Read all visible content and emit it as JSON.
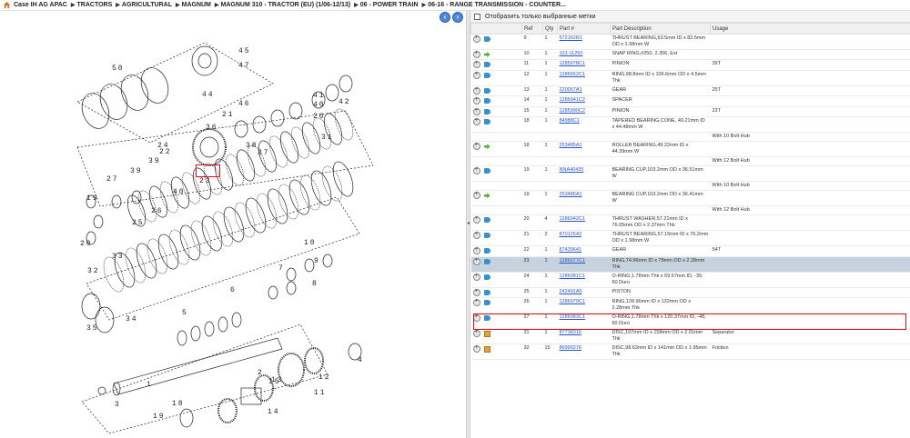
{
  "breadcrumb": [
    "Case IH AG APAC",
    "TRACTORS",
    "AGRICULTURAL",
    "MAGNUM",
    "MAGNUM 310 - TRACTOR (EU) (1/06-12/13)",
    "06 - POWER TRAIN",
    "06-16 - RANGE TRANSMISSION - COUNTER..."
  ],
  "filter_label": "Отобразить только выбранные метки",
  "columns": [
    "",
    "Ref",
    "Qty",
    "Part #",
    "Part Description",
    "Usage"
  ],
  "diagram_labels": [
    "50",
    "45",
    "47",
    "44",
    "42",
    "41",
    "40",
    "20",
    "46",
    "21",
    "36",
    "37",
    "38",
    "22",
    "24",
    "39",
    "23",
    "31",
    "27",
    "39",
    "40",
    "26",
    "25",
    "19",
    "20",
    "33",
    "32",
    "35",
    "34",
    "10",
    "9",
    "8",
    "7",
    "5",
    "6",
    "3",
    "4",
    "1",
    "2",
    "18",
    "19",
    "14",
    "13",
    "11",
    "12",
    "15"
  ],
  "rows": [
    {
      "ref": "9",
      "qty": "1",
      "part": "572162R1",
      "desc": "THRUST BEARING,63.5mm ID x 82.5mm OD x 1.98mm W",
      "usage": "",
      "icon": "blue"
    },
    {
      "ref": "10",
      "qty": "1",
      "part": "101-11250",
      "desc": "SNAP RING,#250, 2.356, Ext",
      "usage": "",
      "icon": "green"
    },
    {
      "ref": "11",
      "qty": "1",
      "part": "1285978C1",
      "desc": "PINION",
      "usage": "39T",
      "icon": "blue"
    },
    {
      "ref": "12",
      "qty": "1",
      "part": "1286652C1",
      "desc": "RING,98.8mm ID x 106.6mm OD x 4.5mm Thk",
      "usage": "",
      "icon": "blue"
    },
    {
      "ref": "13",
      "qty": "1",
      "part": "220057A1",
      "desc": "GEAR",
      "usage": "25T",
      "icon": "blue"
    },
    {
      "ref": "14",
      "qty": "1",
      "part": "1286041C2",
      "desc": "SPACER",
      "usage": "",
      "icon": "blue"
    },
    {
      "ref": "15",
      "qty": "1",
      "part": "1285990C2",
      "desc": "PINION",
      "usage": "23T",
      "icon": "blue"
    },
    {
      "ref": "18",
      "qty": "1",
      "part": "84988C1",
      "desc": "TAPERED BEARING,CONE, 49.21mm ID x 44.48mm W",
      "usage": "",
      "icon": "blue",
      "sub": "With 10 Bolt Hub"
    },
    {
      "ref": "18",
      "qty": "1",
      "part": "253485A1",
      "desc": "ROLLER BEARING,49.22mm ID x 44.39mm W",
      "usage": "",
      "icon": "green",
      "sub": "With 12 Bolt Hub"
    },
    {
      "ref": "19",
      "qty": "1",
      "part": "NNA40435",
      "desc": "BEARING CUP,103.2mm OD x 36.51mm W",
      "usage": "",
      "icon": "blue",
      "sub": "With 10 Bolt Hub"
    },
    {
      "ref": "19",
      "qty": "1",
      "part": "253486A1",
      "desc": "BEARING CUP,103.2mm OD x 36.41mm W",
      "usage": "",
      "icon": "green",
      "sub": "With 12 Bolt Hub"
    },
    {
      "ref": "20",
      "qty": "4",
      "part": "1286042C1",
      "desc": "THRUST WASHER,57.21mm ID x 76.05mm OD x 2.37mm Thk",
      "usage": "",
      "icon": "blue"
    },
    {
      "ref": "21",
      "qty": "2",
      "part": "87012543",
      "desc": "THRUST BEARING,57.15mm ID x 76.2mm OD x 1.98mm W",
      "usage": "",
      "icon": "blue"
    },
    {
      "ref": "22",
      "qty": "1",
      "part": "87439641",
      "desc": "GEAR",
      "usage": "54T",
      "icon": "blue"
    },
    {
      "ref": "23",
      "qty": "1",
      "part": "1286077C1",
      "desc": "RING,74.96mm ID x 78mm OD x 2.28mm Thk",
      "usage": "",
      "icon": "blue",
      "selected": true
    },
    {
      "ref": "24",
      "qty": "1",
      "part": "1286081C1",
      "desc": "O-RING,1.78mm Thk x 69.57mm ID, -39, 60 Duro",
      "usage": "",
      "icon": "blue"
    },
    {
      "ref": "25",
      "qty": "1",
      "part": "242491A5",
      "desc": "PISTON",
      "usage": "",
      "icon": "blue"
    },
    {
      "ref": "26",
      "qty": "1",
      "part": "1286079C1",
      "desc": "RING,128.96mm ID x 132mm OD x 2.28mm Thk",
      "usage": "",
      "icon": "blue"
    },
    {
      "ref": "27",
      "qty": "1",
      "part": "1286083C1",
      "desc": "O-RING,1.78mm Thk x 120.37mm ID, -48, 60 Duro",
      "usage": "",
      "icon": "blue"
    },
    {
      "ref": "31",
      "qty": "1",
      "part": "87738316",
      "desc": "DISC,107mm ID x 158mm OD x 2.01mm Thk",
      "usage": "Separator",
      "icon": "box"
    },
    {
      "ref": "32",
      "qty": "15",
      "part": "86990276",
      "desc": "DISC,98.63mm ID x 141mm OD x 1.95mm Thk",
      "usage": "Friction",
      "icon": "box"
    }
  ]
}
